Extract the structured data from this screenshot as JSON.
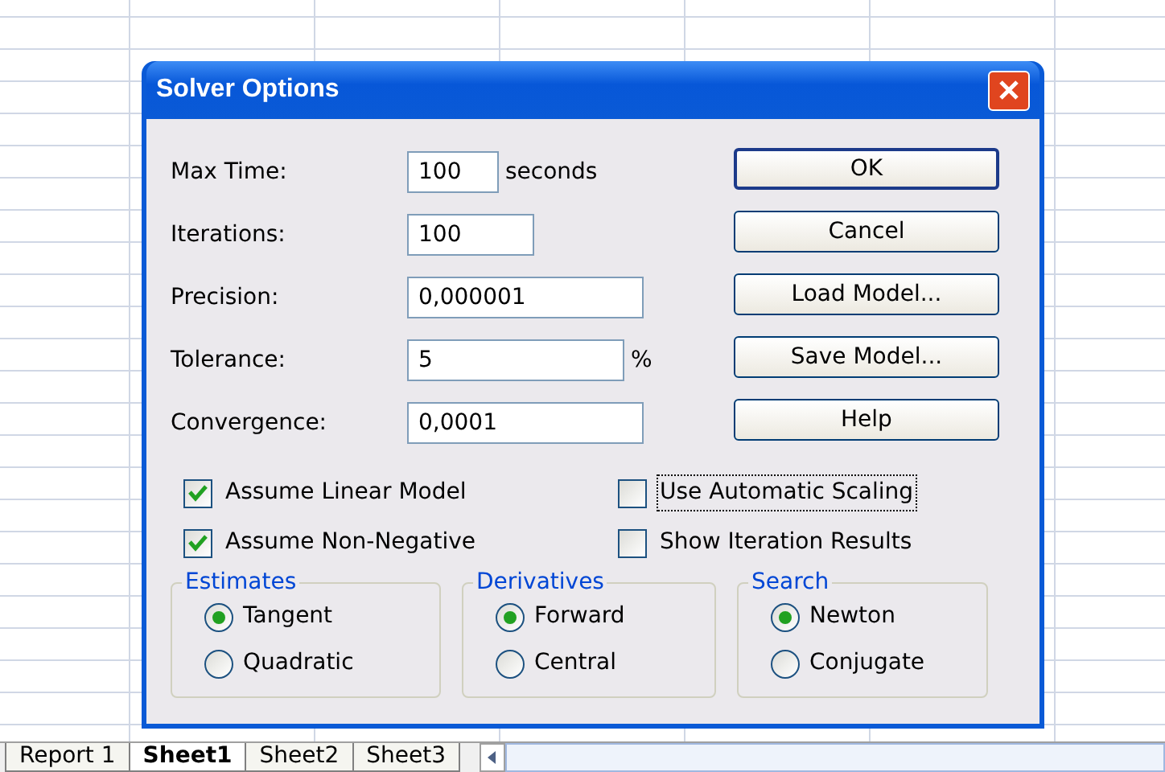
{
  "window": {
    "title": "Solver Options"
  },
  "fields": [
    {
      "label": "Max Time:",
      "value": "100",
      "unit": "seconds"
    },
    {
      "label": "Iterations:",
      "value": "100"
    },
    {
      "label": "Precision:",
      "value": "0,000001"
    },
    {
      "label": "Tolerance:",
      "value": "5",
      "unit": "%"
    },
    {
      "label": "Convergence:",
      "value": "0,0001"
    }
  ],
  "buttons": [
    {
      "label": "OK",
      "default": true
    },
    {
      "label": "Cancel",
      "default": false
    },
    {
      "label": "Load Model...",
      "default": false
    },
    {
      "label": "Save Model...",
      "default": false
    },
    {
      "label": "Help",
      "default": false
    }
  ],
  "checkboxes": [
    {
      "label": "Assume Linear Model",
      "checked": true,
      "focused": false
    },
    {
      "label": "Use Automatic Scaling",
      "checked": false,
      "focused": true
    },
    {
      "label": "Assume Non-Negative",
      "checked": true,
      "focused": false
    },
    {
      "label": "Show Iteration Results",
      "checked": false,
      "focused": false
    }
  ],
  "groups": [
    {
      "title": "Estimates",
      "options": [
        {
          "label": "Tangent",
          "selected": true
        },
        {
          "label": "Quadratic",
          "selected": false
        }
      ]
    },
    {
      "title": "Derivatives",
      "options": [
        {
          "label": "Forward",
          "selected": true
        },
        {
          "label": "Central",
          "selected": false
        }
      ]
    },
    {
      "title": "Search",
      "options": [
        {
          "label": "Newton",
          "selected": true
        },
        {
          "label": "Conjugate",
          "selected": false
        }
      ]
    }
  ],
  "sheet_tabs": [
    {
      "label": "Report 1",
      "selected": false
    },
    {
      "label": "Sheet1",
      "selected": true
    },
    {
      "label": "Sheet2",
      "selected": false
    },
    {
      "label": "Sheet3",
      "selected": false
    }
  ]
}
